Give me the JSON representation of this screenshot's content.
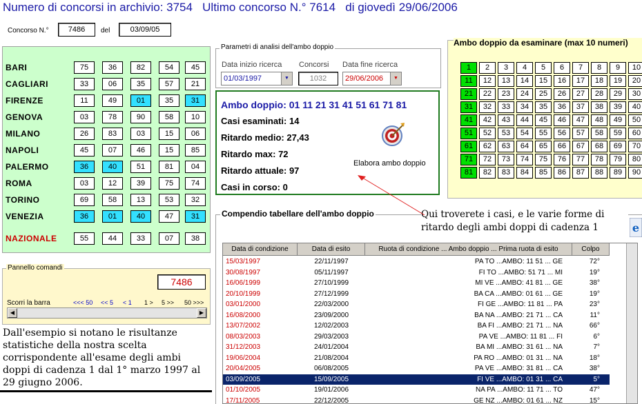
{
  "header": {
    "archive_text": "Numero di concorsi in archivio: 3754",
    "last_text": "Ultimo concorso N.° 7614   di giovedì 29/06/2006"
  },
  "concorso": {
    "label": "Concorso N.°",
    "number": "7486",
    "del_label": "del",
    "date": "03/09/05"
  },
  "wheels": [
    {
      "name": "BARI",
      "nums": [
        "75",
        "36",
        "82",
        "54",
        "45"
      ],
      "hl": []
    },
    {
      "name": "CAGLIARI",
      "nums": [
        "33",
        "06",
        "35",
        "57",
        "21"
      ],
      "hl": []
    },
    {
      "name": "FIRENZE",
      "nums": [
        "11",
        "49",
        "01",
        "35",
        "31"
      ],
      "hl": [
        2,
        4
      ]
    },
    {
      "name": "GENOVA",
      "nums": [
        "03",
        "78",
        "90",
        "58",
        "10"
      ],
      "hl": []
    },
    {
      "name": "MILANO",
      "nums": [
        "26",
        "83",
        "03",
        "15",
        "06"
      ],
      "hl": []
    },
    {
      "name": "NAPOLI",
      "nums": [
        "45",
        "07",
        "46",
        "15",
        "85"
      ],
      "hl": []
    },
    {
      "name": "PALERMO",
      "nums": [
        "36",
        "40",
        "51",
        "81",
        "04"
      ],
      "hl": [
        0,
        1
      ]
    },
    {
      "name": "ROMA",
      "nums": [
        "03",
        "12",
        "39",
        "75",
        "74"
      ],
      "hl": []
    },
    {
      "name": "TORINO",
      "nums": [
        "69",
        "58",
        "13",
        "53",
        "32"
      ],
      "hl": []
    },
    {
      "name": "VENEZIA",
      "nums": [
        "36",
        "01",
        "40",
        "47",
        "31"
      ],
      "hl": [
        0,
        1,
        2,
        4
      ]
    },
    {
      "name": "NAZIONALE",
      "nums": [
        "55",
        "44",
        "33",
        "07",
        "38"
      ],
      "hl": [],
      "red": true
    }
  ],
  "pannello": {
    "legend": "Pannello comandi",
    "value": "7486",
    "scorri": "Scorri la barra",
    "nav": [
      "<<< 50",
      "<< 5",
      "< 1",
      "1 >",
      "5 >>",
      "50 >>>"
    ]
  },
  "explain": "Dall'esempio si notano le risultanze statistiche della nostra scelta corrispondente all'esame degli ambi doppi di cadenza 1 dal 1° marzo 1997 al 29 giugno 2006.",
  "params": {
    "legend": "Parametri di analisi dell'ambo doppio",
    "start_label": "Data inizio ricerca",
    "start_value": "01/03/1997",
    "concorsi_label": "Concorsi",
    "concorsi_value": "1032",
    "end_label": "Data fine ricerca",
    "end_value": "29/06/2006"
  },
  "result": {
    "ambo": "Ambo doppio: 01 11 21 31 41 51 61 71 81",
    "casi": "Casi esaminati: 14",
    "medio": "Ritardo medio: 27,43",
    "max": "Ritardo max: 72",
    "attuale": "Ritardo attuale: 97",
    "in_corso": "Casi in corso: 0",
    "elabora": "Elabora ambo doppio"
  },
  "grid": {
    "title": "Ambo doppio da esaminare (max 10 numeri)",
    "highlight": [
      1,
      11,
      21,
      31,
      41,
      51,
      61,
      71,
      81
    ]
  },
  "compendio": {
    "legend": "Compendio tabellare dell'ambo doppio",
    "note": "Qui troverete i casi, e le varie forme di ritardo degli ambi doppi di cadenza 1",
    "headers": [
      "Data di condizione",
      "Data di esito",
      "Ruota di condizione ... Ambo doppio ... Prima ruota di esito",
      "Colpo"
    ],
    "rows": [
      [
        "15/03/1997",
        "22/11/1997",
        "PA TO ...AMBO: 11 51 ... GE",
        "72°"
      ],
      [
        "30/08/1997",
        "05/11/1997",
        "FI TO ...AMBO: 51 71 ... MI",
        "19°"
      ],
      [
        "16/06/1999",
        "27/10/1999",
        "MI VE ...AMBO: 41 81 ... GE",
        "38°"
      ],
      [
        "20/10/1999",
        "27/12/1999",
        "BA CA ...AMBO: 01 61 ... GE",
        "19°"
      ],
      [
        "03/01/2000",
        "22/03/2000",
        "FI GE ...AMBO: 11 81 ... PA",
        "23°"
      ],
      [
        "16/08/2000",
        "23/09/2000",
        "BA NA ...AMBO: 21 71 ... CA",
        "11°"
      ],
      [
        "13/07/2002",
        "12/02/2003",
        "BA FI ...AMBO: 21 71 ... NA",
        "66°"
      ],
      [
        "08/03/2003",
        "29/03/2003",
        "PA VE ...AMBO: 11 81 ... FI",
        "6°"
      ],
      [
        "31/12/2003",
        "24/01/2004",
        "BA MI ...AMBO: 31 61 ... NA",
        "7°"
      ],
      [
        "19/06/2004",
        "21/08/2004",
        "PA RO ...AMBO: 01 31 ... NA",
        "18°"
      ],
      [
        "20/04/2005",
        "06/08/2005",
        "PA VE ...AMBO: 31 81 ... CA",
        "38°"
      ],
      [
        "03/09/2005",
        "15/09/2005",
        "FI VE ...AMBO: 01 31 ... CA",
        "5°"
      ],
      [
        "01/10/2005",
        "19/01/2006",
        "NA PA ...AMBO: 11 71 ... TO",
        "47°"
      ],
      [
        "17/11/2005",
        "22/12/2005",
        "GE NZ ...AMBO: 01 61 ... NZ",
        "15°"
      ]
    ],
    "selected_row": 11
  },
  "colors": {
    "title_blue": "#1a1aa6",
    "wheel_bg": "#ccffcc",
    "highlight_cyan": "#33e0ff",
    "grid_green": "#00e000",
    "red": "#cc0000",
    "selection": "#0a246a"
  }
}
